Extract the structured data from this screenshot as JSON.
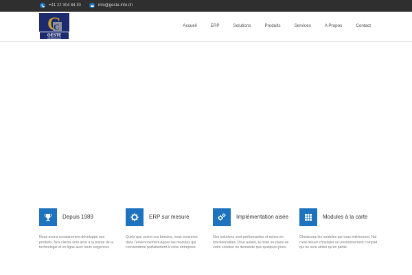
{
  "topbar": {
    "phone": "+41 22 304 84 30",
    "email": "info@geste-info.ch",
    "phone_icon": "phone-icon",
    "email_icon": "envelope-icon"
  },
  "logo": {
    "name": "GESTE",
    "sub": "INFORMATIQUE"
  },
  "nav": {
    "items": [
      "Accueil",
      "ERP",
      "Solutions",
      "Produits",
      "Services",
      "A Propos",
      "Contact"
    ]
  },
  "features": [
    {
      "icon": "trophy-icon",
      "title": "Depuis 1989",
      "desc": "Nous avons constamment développé nos produits. Nos clients sont ainsi à la pointe de la technologie et en ligne avec leurs exigences."
    },
    {
      "icon": "gear-icon",
      "title": "ERP sur mesure",
      "desc": "Quels que soient vos besoins, vous trouverez dans l'environnement Agoss les modules qui conviendront parfaitement à votre entreprise."
    },
    {
      "icon": "gears-icon",
      "title": "Implémentation aisée",
      "desc": "Nos solutions sont performantes et riches en fonctionnalités. Pour autant, la mise en place de votre solution ne demande que quelques jours."
    },
    {
      "icon": "grid-icon",
      "title": "Modules à la carte",
      "desc": "Choisissez les modules qui vous intéressent. Nul n'est besoin d'installer un environnement complet qui ne sera utilisé qu'en partie."
    }
  ],
  "colors": {
    "accent": "#1e73be",
    "topbar": "#2f2f2f",
    "logo_bg": "#1d2a6e",
    "logo_gold": "#c9a227"
  }
}
